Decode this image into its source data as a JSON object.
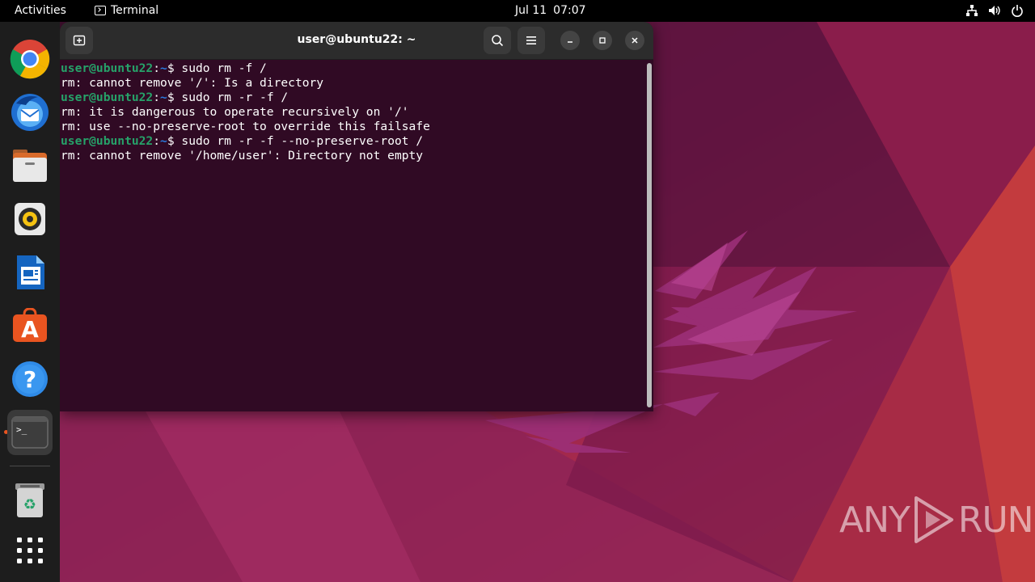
{
  "topbar": {
    "activities": "Activities",
    "app_name": "Terminal",
    "date": "Jul 11",
    "time": "07:07",
    "tray_icons": [
      "network-icon",
      "volume-icon",
      "power-icon"
    ]
  },
  "dock": {
    "items": [
      {
        "name": "chrome",
        "icon": "chrome-icon",
        "active": false
      },
      {
        "name": "thunderbird",
        "icon": "thunderbird-icon",
        "active": false
      },
      {
        "name": "files",
        "icon": "files-icon",
        "active": false
      },
      {
        "name": "rhythmbox",
        "icon": "rhythmbox-icon",
        "active": false
      },
      {
        "name": "libreoffice-writer",
        "icon": "writer-icon",
        "active": false
      },
      {
        "name": "app-center",
        "icon": "app-center-icon",
        "active": false
      },
      {
        "name": "help",
        "icon": "help-icon",
        "active": false
      },
      {
        "name": "terminal",
        "icon": "terminal-icon",
        "active": true
      },
      {
        "name": "trash",
        "icon": "trash-icon",
        "active": false
      },
      {
        "name": "show-apps",
        "icon": "grid-icon",
        "active": false
      }
    ]
  },
  "terminal": {
    "title": "user@ubuntu22: ~",
    "lines": [
      {
        "type": "prompt",
        "user": "user@ubuntu22",
        "sep": ":",
        "path": "~",
        "sym": "$ ",
        "cmd": "sudo rm -f /"
      },
      {
        "type": "output",
        "text": "rm: cannot remove '/': Is a directory"
      },
      {
        "type": "prompt",
        "user": "user@ubuntu22",
        "sep": ":",
        "path": "~",
        "sym": "$ ",
        "cmd": "sudo rm -r -f /"
      },
      {
        "type": "output",
        "text": "rm: it is dangerous to operate recursively on '/'"
      },
      {
        "type": "output",
        "text": "rm: use --no-preserve-root to override this failsafe"
      },
      {
        "type": "prompt",
        "user": "user@ubuntu22",
        "sep": ":",
        "path": "~",
        "sym": "$ ",
        "cmd": "sudo rm -r -f --no-preserve-root /"
      },
      {
        "type": "output",
        "text": "rm: cannot remove '/home/user': Directory not empty"
      }
    ]
  },
  "watermark": {
    "left": "ANY",
    "right": "RUN"
  },
  "colors": {
    "terminal_bg": "#300a24",
    "prompt_user": "#26a269",
    "prompt_path": "#2a7bde",
    "accent": "#e95420"
  }
}
